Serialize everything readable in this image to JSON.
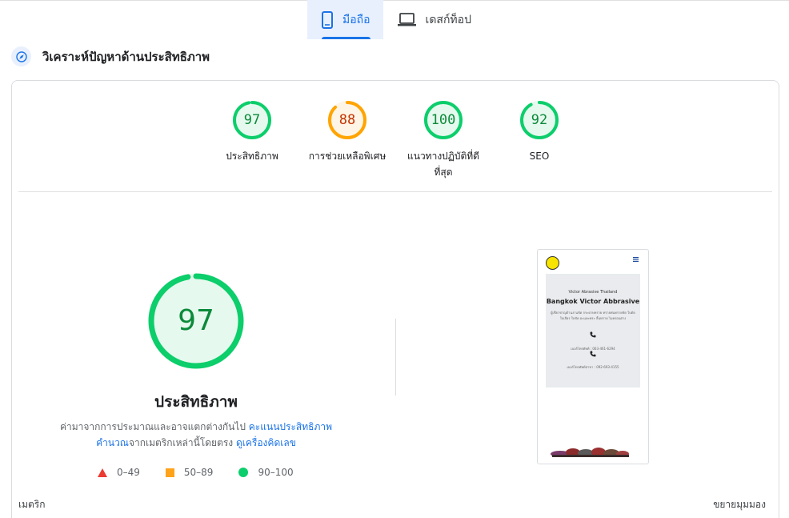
{
  "tabs": [
    {
      "label": "มือถือ",
      "icon": "smartphone-icon",
      "active": true
    },
    {
      "label": "เดสก์ท็อป",
      "icon": "laptop-icon",
      "active": false
    }
  ],
  "diagnose": {
    "title": "วิเคราะห์ปัญหาด้านประสิทธิภาพ",
    "icon": "compass-icon"
  },
  "gauges": [
    {
      "score": "97",
      "label": "ประสิทธิภาพ",
      "value": 97,
      "status": "pass"
    },
    {
      "score": "88",
      "label": "การช่วยเหลือพิเศษ",
      "value": 88,
      "status": "average"
    },
    {
      "score": "100",
      "label_line1": "แนวทางปฏิบัติที่ดี",
      "label_line2": "ที่สุด",
      "value": 100,
      "status": "pass"
    },
    {
      "score": "92",
      "label": "SEO",
      "value": 92,
      "status": "pass"
    }
  ],
  "colors": {
    "pass": "#0cce6b",
    "pass_text": "#0a8a3a",
    "pass_fill": "#e6f9ee",
    "average": "#ffa400",
    "average_text": "#c33300",
    "average_fill": "#fff5e6",
    "fail": "#eb3b32",
    "accent": "#1a73e8"
  },
  "main": {
    "score": "97",
    "value": 97,
    "title": "ประสิทธิภาพ",
    "desc_part1": "ค่ามาจากการประมาณและอาจแตกต่างกันไป ",
    "desc_link1": "คะแนนประสิทธิภาพคำนวณ",
    "desc_part2": "จากเมตริกเหล่านี้โดยตรง ",
    "desc_link2": "ดูเครื่องคิดเลข"
  },
  "legend": [
    {
      "shape": "triangle",
      "range": "0–49"
    },
    {
      "shape": "square",
      "range": "50–89"
    },
    {
      "shape": "circle",
      "range": "90–100"
    }
  ],
  "screenshot": {
    "eyebrow": "Victor Abrasive Thailand",
    "headline": "Bangkok Victor Abbrasive",
    "body": "ผู้เชี่ยวชาญด้านงานขัด กระดาษทราย ทรายพ่นทรายขัด ใบตัด ใบเจียร ใบขัด อะแคะพระ ลิ้นทราย ไมครอนต่าง",
    "phone_label1": "เบอร์โทรศัพท์ : 063-461-6294",
    "phone_label2": "เบอร์โทรศัพท์สาขา : 092-693-4155",
    "menu_icon": "hamburger-menu-icon",
    "logo_icon": "victor-logo-icon",
    "phone_icon": "phone-icon"
  },
  "footer": {
    "metrics_label": "เมตริก",
    "expand_label": "ขยายมุมมอง"
  }
}
